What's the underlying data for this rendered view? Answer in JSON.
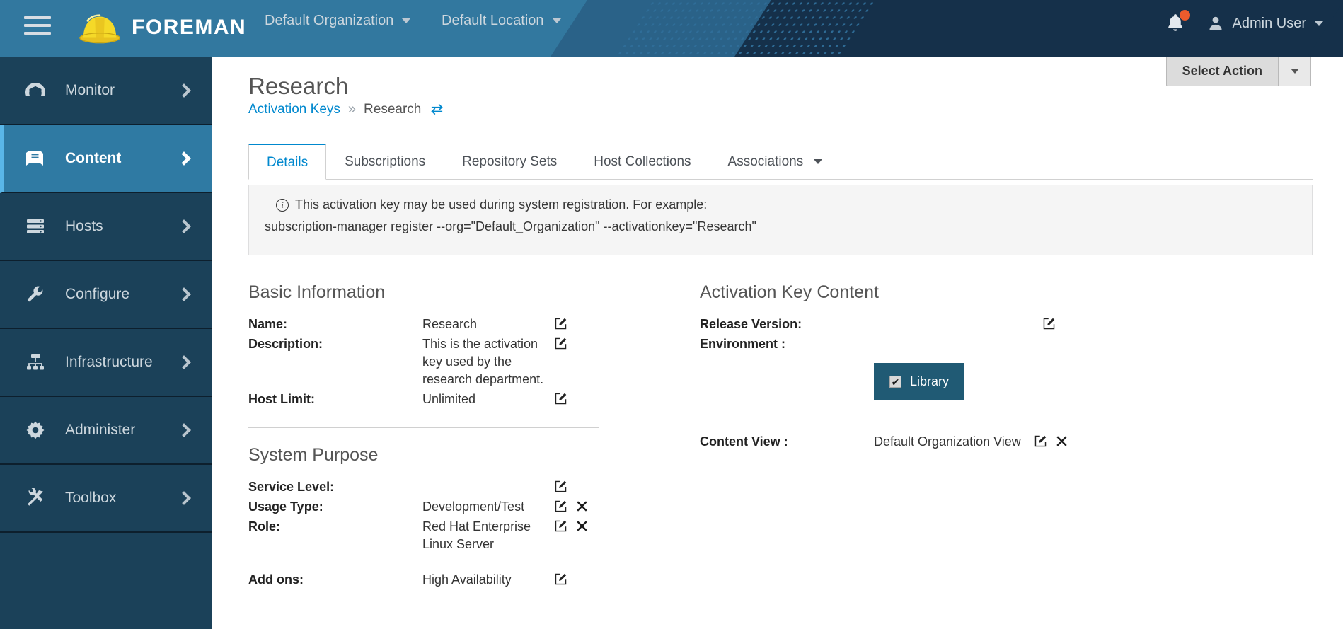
{
  "masthead": {
    "menu_icon": "hamburger-icon",
    "logo_icon": "foreman-hardhat-logo",
    "brand": "FOREMAN",
    "organization": "Default Organization",
    "location": "Default Location",
    "notifications_icon": "bell-icon",
    "user_name": "Admin User",
    "user_icon": "user-avatar-icon"
  },
  "sidebar": {
    "items": [
      {
        "label": "Monitor",
        "icon": "dashboard-icon",
        "active": false
      },
      {
        "label": "Content",
        "icon": "book-icon",
        "active": true
      },
      {
        "label": "Hosts",
        "icon": "server-rack-icon",
        "active": false
      },
      {
        "label": "Configure",
        "icon": "wrench-icon",
        "active": false
      },
      {
        "label": "Infrastructure",
        "icon": "sitemap-icon",
        "active": false
      },
      {
        "label": "Administer",
        "icon": "gear-icon",
        "active": false
      },
      {
        "label": "Toolbox",
        "icon": "tools-icon",
        "active": false
      }
    ]
  },
  "page": {
    "title": "Research",
    "select_action_label": "Select Action"
  },
  "breadcrumb": {
    "root": "Activation Keys",
    "separator": "»",
    "current": "Research",
    "switch_icon": "exchange-icon"
  },
  "tabs": [
    {
      "label": "Details",
      "active": true,
      "has_caret": false
    },
    {
      "label": "Subscriptions",
      "active": false,
      "has_caret": false
    },
    {
      "label": "Repository Sets",
      "active": false,
      "has_caret": false
    },
    {
      "label": "Host Collections",
      "active": false,
      "has_caret": false
    },
    {
      "label": "Associations",
      "active": false,
      "has_caret": true
    }
  ],
  "alert": {
    "icon": "info-circle-icon",
    "line1": "This activation key may be used during system registration. For example:",
    "line2": "subscription-manager register --org=\"Default_Organization\" --activationkey=\"Research\""
  },
  "basic_information": {
    "heading": "Basic Information",
    "rows": [
      {
        "label": "Name:",
        "value": "Research",
        "edit": true,
        "remove": false
      },
      {
        "label": "Description:",
        "value": "This is the activation key used by the research department.",
        "edit": true,
        "remove": false
      },
      {
        "label": "Host Limit:",
        "value": "Unlimited",
        "edit": true,
        "remove": false
      }
    ]
  },
  "system_purpose": {
    "heading": "System Purpose",
    "rows": [
      {
        "label": "Service Level:",
        "value": "",
        "edit": true,
        "remove": false
      },
      {
        "label": "Usage Type:",
        "value": "Development/Test",
        "edit": true,
        "remove": true
      },
      {
        "label": "Role:",
        "value": "Red Hat Enterprise Linux Server",
        "edit": true,
        "remove": true
      },
      {
        "label": "Add ons:",
        "value": "High Availability",
        "edit": true,
        "remove": false
      }
    ]
  },
  "activation_key_content": {
    "heading": "Activation Key Content",
    "release_version_label": "Release Version:",
    "release_version_value": "",
    "environment_label": "Environment :",
    "environment_selected": "Library",
    "content_view_label": "Content View :",
    "content_view_value": "Default Organization View"
  },
  "icons": {
    "edit": "edit-pencil-icon",
    "remove": "remove-x-icon",
    "chevron": "chevron-right-icon"
  },
  "colors": {
    "masthead_left": "#32789f",
    "masthead_right": "#15304a",
    "sidebar_bg": "#1b4159",
    "sidebar_active": "#2f7aa3",
    "sidebar_accent": "#59b6e8",
    "link_blue": "#0088ce",
    "badge_orange": "#ec5b2c",
    "env_chip": "#205a74"
  }
}
